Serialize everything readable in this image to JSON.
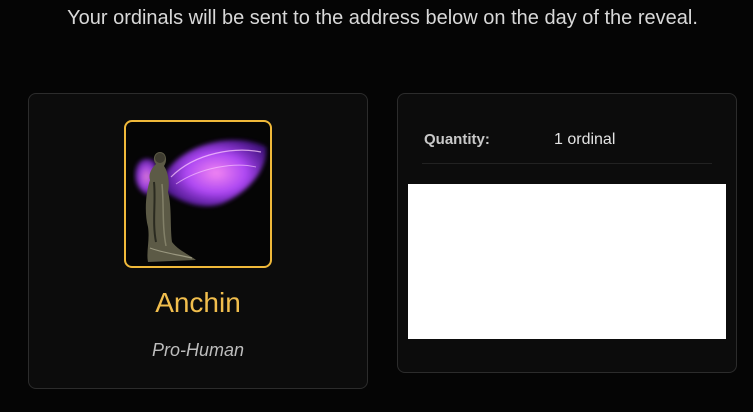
{
  "notice": "Your ordinals will be sent to the address below on the day of the reveal.",
  "item": {
    "image_alt": "winged figure ordinal artwork",
    "name": "Anchin",
    "type": "Pro-Human",
    "accent_color": "#f0b93a"
  },
  "summary": {
    "quantity_label": "Quantity:",
    "quantity_value": "1 ordinal"
  }
}
